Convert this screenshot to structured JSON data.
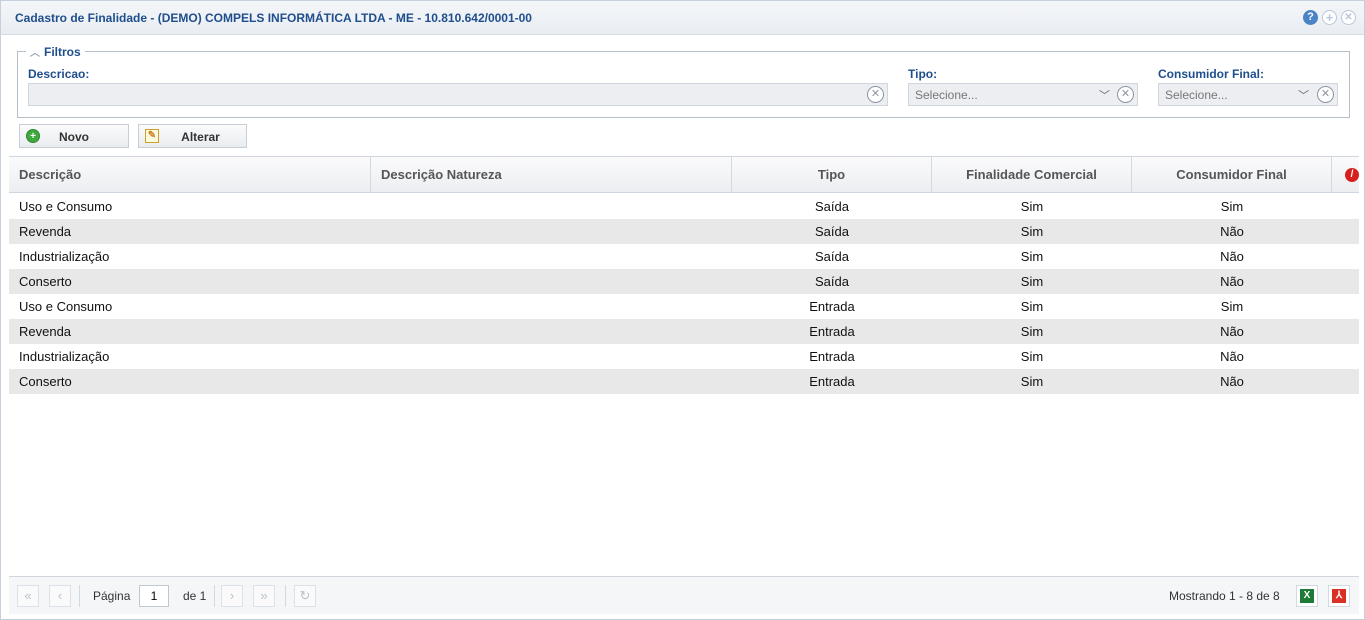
{
  "window": {
    "title": "Cadastro de Finalidade - (DEMO) COMPELS INFORMÁTICA LTDA - ME - 10.810.642/0001-00",
    "icons": [
      "help-icon",
      "maximize-icon",
      "close-icon"
    ]
  },
  "filters": {
    "legend": "Filtros",
    "descricao": {
      "label": "Descricao:",
      "value": "",
      "placeholder": ""
    },
    "tipo": {
      "label": "Tipo:",
      "value": "Selecione..."
    },
    "consumidor_final": {
      "label": "Consumidor Final:",
      "value": "Selecione..."
    }
  },
  "toolbar": {
    "novo_label": "Novo",
    "alterar_label": "Alterar"
  },
  "grid": {
    "columns": [
      "Descrição",
      "Descrição Natureza",
      "Tipo",
      "Finalidade Comercial",
      "Consumidor Final"
    ],
    "rows": [
      {
        "descricao": "Uso e Consumo",
        "natureza": "",
        "tipo": "Saída",
        "finalidade": "Sim",
        "consumidor": "Sim"
      },
      {
        "descricao": "Revenda",
        "natureza": "",
        "tipo": "Saída",
        "finalidade": "Sim",
        "consumidor": "Não"
      },
      {
        "descricao": "Industrialização",
        "natureza": "",
        "tipo": "Saída",
        "finalidade": "Sim",
        "consumidor": "Não"
      },
      {
        "descricao": "Conserto",
        "natureza": "",
        "tipo": "Saída",
        "finalidade": "Sim",
        "consumidor": "Não"
      },
      {
        "descricao": "Uso e Consumo",
        "natureza": "",
        "tipo": "Entrada",
        "finalidade": "Sim",
        "consumidor": "Sim"
      },
      {
        "descricao": "Revenda",
        "natureza": "",
        "tipo": "Entrada",
        "finalidade": "Sim",
        "consumidor": "Não"
      },
      {
        "descricao": "Industrialização",
        "natureza": "",
        "tipo": "Entrada",
        "finalidade": "Sim",
        "consumidor": "Não"
      },
      {
        "descricao": "Conserto",
        "natureza": "",
        "tipo": "Entrada",
        "finalidade": "Sim",
        "consumidor": "Não"
      }
    ]
  },
  "pager": {
    "page_label": "Página",
    "page_value": "1",
    "of_label": "de 1",
    "status": "Mostrando 1 - 8 de 8"
  }
}
